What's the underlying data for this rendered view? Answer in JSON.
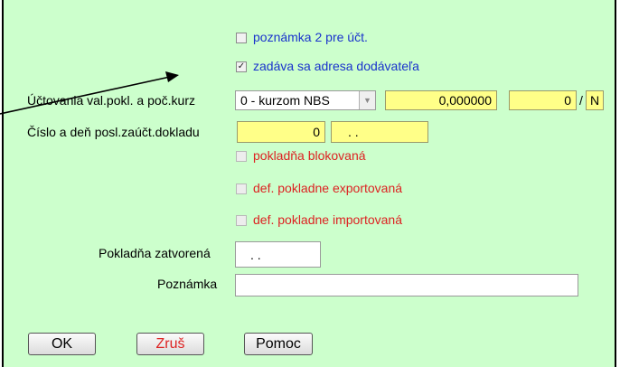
{
  "top_cut_text": "... ",
  "checkboxes": {
    "note2": {
      "label": "poznámka 2 pre účt.",
      "checked": false
    },
    "supplier_address": {
      "label": "zadáva sa adresa dodávateľa",
      "checked": true
    },
    "register_blocked": {
      "label": "pokladňa blokovaná",
      "checked": false
    },
    "def_exported": {
      "label": "def. pokladne exportovaná",
      "checked": false
    },
    "def_imported": {
      "label": "def. pokladne importovaná",
      "checked": false
    }
  },
  "rate_row": {
    "label": "Účtovania val.pokl. a poč.kurz",
    "select_value": "0 - kurzom NBS",
    "rate_value": "0,000000",
    "count_value": "0",
    "separator": "/",
    "flag_value": "N"
  },
  "doc_row": {
    "label": "Číslo a deň posl.zaúčt.dokladu",
    "number_value": "0",
    "date_value": ". ."
  },
  "closed_row": {
    "label": "Pokladňa zatvorená",
    "date_value": ". ."
  },
  "note_row": {
    "label": "Poznámka",
    "value": ""
  },
  "buttons": {
    "ok": "OK",
    "cancel": "Zruš",
    "help": "Pomoc"
  },
  "colors": {
    "panel_bg": "#ccffcc",
    "field_bg": "#ffff88",
    "label_blue": "#1a33cc",
    "label_red": "#dd2222",
    "cancel_text": "#dd2222"
  }
}
